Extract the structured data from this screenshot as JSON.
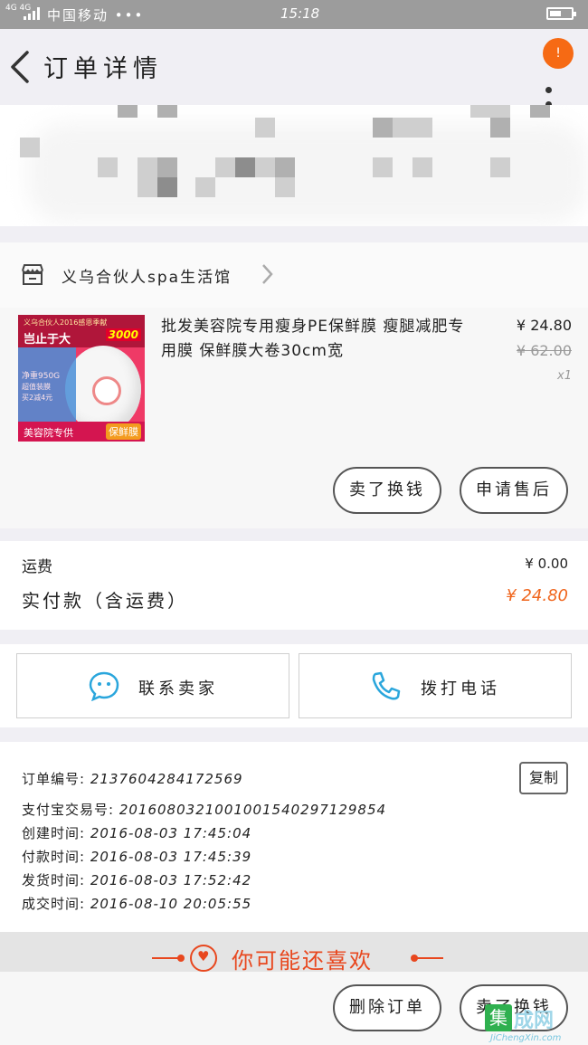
{
  "status_bar": {
    "network": "4G 4G",
    "carrier": "中国移动 •••",
    "time": "15:18"
  },
  "header": {
    "title": "订单详情",
    "notification_count": "!"
  },
  "shop": {
    "name": "义乌合伙人spa生活馆"
  },
  "item": {
    "title": "批发美容院专用瘦身PE保鲜膜 瘦腿减肥专用膜 保鲜膜大卷30cm宽",
    "price": "¥ 24.80",
    "original_price": "¥ 62.00",
    "quantity": "x1",
    "thumb": {
      "banner_small": "义乌合伙人2016感恩季献",
      "banner_big": "岂止于大",
      "banner_badge": "3000",
      "film_1": "净重950G",
      "film_2": "超值装膜",
      "film_3": "买2减4元",
      "bottom_left": "美容院专供",
      "bottom_right": "保鲜膜"
    },
    "buttons": {
      "sold_again": "卖了换钱",
      "after_sale": "申请售后"
    }
  },
  "payment": {
    "shipping_label": "运费",
    "shipping_value": "¥ 0.00",
    "paid_label": "实付款（含运费）",
    "paid_value": "¥ 24.80"
  },
  "contact": {
    "seller_label": "联系卖家",
    "phone_label": "拨打电话"
  },
  "order_info": {
    "order_no_label": "订单编号:",
    "order_no": "2137604284172569",
    "copy_label": "复制",
    "alipay_label": "支付宝交易号:",
    "alipay_no": "2016080321001001540297129854",
    "created_label": "创建时间:",
    "created": "2016-08-03 17:45:04",
    "paid_label": "付款时间:",
    "paid": "2016-08-03 17:45:39",
    "shipped_label": "发货时间:",
    "shipped": "2016-08-03 17:52:42",
    "completed_label": "成交时间:",
    "completed": "2016-08-10 20:05:55"
  },
  "recommend": {
    "title": "你可能还喜欢"
  },
  "footer": {
    "delete_label": "删除订单",
    "sell_label": "卖了换钱"
  },
  "watermark": {
    "text": "JiChengXin.com"
  },
  "colors": {
    "accent": "#f0661e",
    "contact_icon": "#2aa6dc"
  }
}
